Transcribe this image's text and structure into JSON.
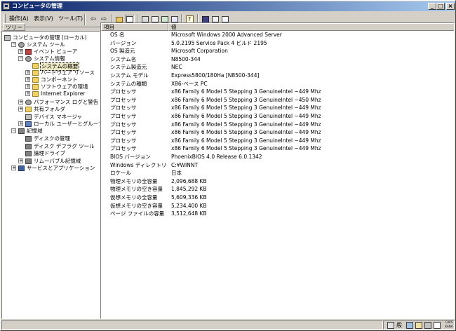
{
  "window": {
    "title": "コンピュータの管理"
  },
  "menubar": {
    "items": [
      "操作(A)",
      "表示(V)",
      "ツール(T)"
    ]
  },
  "toolbar": {
    "back_icon": "back-arrow-icon",
    "forward_icon": "forward-arrow-icon"
  },
  "tree": {
    "header": "ツリー",
    "items": [
      {
        "label": "コンピュータの管理 (ローカル)",
        "icon": "computer-icon",
        "expander": ""
      },
      {
        "label": "システム ツール",
        "icon": "tools-icon",
        "expander": "−"
      },
      {
        "label": "イベント ビューア",
        "icon": "event-viewer-icon",
        "expander": "+"
      },
      {
        "label": "システム情報",
        "icon": "system-info-icon",
        "expander": "−"
      },
      {
        "label": "システムの概要",
        "icon": "folder-icon",
        "expander": ""
      },
      {
        "label": "ハードウェア リソース",
        "icon": "folder-icon",
        "expander": "+"
      },
      {
        "label": "コンポーネント",
        "icon": "folder-icon",
        "expander": "+"
      },
      {
        "label": "ソフトウェアの環境",
        "icon": "folder-icon",
        "expander": "+"
      },
      {
        "label": "Internet Explorer",
        "icon": "folder-icon",
        "expander": "+"
      },
      {
        "label": "パフォーマンス ログと警告",
        "icon": "performance-icon",
        "expander": "+"
      },
      {
        "label": "共有フォルダ",
        "icon": "shared-folder-icon",
        "expander": "+"
      },
      {
        "label": "デバイス マネージャ",
        "icon": "device-manager-icon",
        "expander": ""
      },
      {
        "label": "ローカル ユーザーとグループ",
        "icon": "users-icon",
        "expander": "+"
      },
      {
        "label": "記憶域",
        "icon": "storage-icon",
        "expander": "−"
      },
      {
        "label": "ディスクの管理",
        "icon": "disk-icon",
        "expander": ""
      },
      {
        "label": "ディスク デフラグ ツール",
        "icon": "defrag-icon",
        "expander": ""
      },
      {
        "label": "論理ドライブ",
        "icon": "drive-icon",
        "expander": ""
      },
      {
        "label": "リムーバブル記憶域",
        "icon": "removable-storage-icon",
        "expander": "+"
      },
      {
        "label": "サービスとアプリケーション",
        "icon": "services-icon",
        "expander": "+"
      }
    ]
  },
  "list": {
    "columns": [
      "項目",
      "値"
    ],
    "rows": [
      {
        "item": "OS 名",
        "value": "Microsoft Windows 2000 Advanced Server"
      },
      {
        "item": "バージョン",
        "value": "5.0.2195 Service Pack 4 ビルド 2195"
      },
      {
        "item": "OS 製造元",
        "value": "Microsoft Corporation"
      },
      {
        "item": "システム名",
        "value": "N8500-344"
      },
      {
        "item": "システム製造元",
        "value": "NEC"
      },
      {
        "item": "システム モデル",
        "value": "Express5800/180Ha [N8500-344]"
      },
      {
        "item": "システムの種類",
        "value": "X86-ベース PC"
      },
      {
        "item": "プロセッサ",
        "value": "x86 Family 6 Model 5 Stepping 3 GenuineIntel ~449 Mhz"
      },
      {
        "item": "プロセッサ",
        "value": "x86 Family 6 Model 5 Stepping 3 GenuineIntel ~450 Mhz"
      },
      {
        "item": "プロセッサ",
        "value": "x86 Family 6 Model 5 Stepping 3 GenuineIntel ~449 Mhz"
      },
      {
        "item": "プロセッサ",
        "value": "x86 Family 6 Model 5 Stepping 3 GenuineIntel ~449 Mhz"
      },
      {
        "item": "プロセッサ",
        "value": "x86 Family 6 Model 5 Stepping 3 GenuineIntel ~449 Mhz"
      },
      {
        "item": "プロセッサ",
        "value": "x86 Family 6 Model 5 Stepping 3 GenuineIntel ~449 Mhz"
      },
      {
        "item": "プロセッサ",
        "value": "x86 Family 6 Model 5 Stepping 3 GenuineIntel ~449 Mhz"
      },
      {
        "item": "プロセッサ",
        "value": "x86 Family 6 Model 5 Stepping 3 GenuineIntel ~449 Mhz"
      },
      {
        "item": "BIOS バージョン",
        "value": "PhoenixBIOS 4.0 Release 6.0.1342"
      },
      {
        "item": "Windows ディレクトリ",
        "value": "C:¥WINNT"
      },
      {
        "item": "ロケール",
        "value": "日本"
      },
      {
        "item": "物理メモリの全容量",
        "value": "2,096,688 KB"
      },
      {
        "item": "物理メモリの空き容量",
        "value": "1,845,292 KB"
      },
      {
        "item": "仮想メモリの全容量",
        "value": "5,609,336 KB"
      },
      {
        "item": "仮想メモリの空き容量",
        "value": "5,234,400 KB"
      },
      {
        "item": "ページ ファイルの容量",
        "value": "3,512,648 KB"
      }
    ]
  },
  "statusbar": {
    "ime": "般",
    "caps": "CAPS",
    "kana": "KANA"
  }
}
